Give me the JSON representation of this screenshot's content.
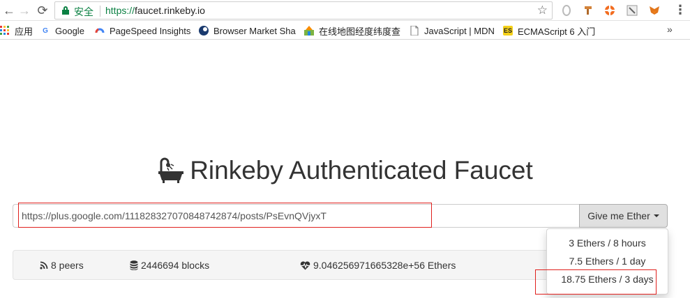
{
  "browser": {
    "security_label": "安全",
    "url_scheme": "https://",
    "url_host": "faucet.rinkeby.io",
    "icons": {
      "back": "arrow-left-icon",
      "forward": "arrow-right-icon",
      "reload": "reload-icon",
      "bookmark": "star-icon",
      "menu": "more-vert-icon"
    }
  },
  "bookmarks": {
    "items": [
      {
        "label": "应用",
        "icon": "apps-grid-icon"
      },
      {
        "label": "Google",
        "icon": "google-icon"
      },
      {
        "label": "PageSpeed Insights",
        "icon": "pagespeed-icon"
      },
      {
        "label": "Browser Market Sha",
        "icon": "browser-market-icon"
      },
      {
        "label": "在线地图经度纬度查",
        "icon": "map-icon"
      },
      {
        "label": "JavaScript | MDN",
        "icon": "document-icon"
      },
      {
        "label": "ECMAScript 6 入门",
        "icon": "es-icon"
      }
    ],
    "overflow_label": "»"
  },
  "page": {
    "title": "Rinkeby Authenticated Faucet",
    "input_value": "https://plus.google.com/111828327070848742874/posts/PsEvnQVjyxT",
    "give_button_label": "Give me Ether",
    "stats": {
      "peers": "8 peers",
      "blocks": "2446694 blocks",
      "funds": "9.046256971665328e+56 Ethers"
    },
    "dropdown_options": [
      "3 Ethers / 8 hours",
      "7.5 Ethers / 1 day",
      "18.75 Ethers / 3 days"
    ]
  },
  "colors": {
    "secure_green": "#0b8043",
    "highlight_red": "#e0201d",
    "button_gray": "#e0e0e0",
    "stats_bg": "#f5f5f5"
  }
}
